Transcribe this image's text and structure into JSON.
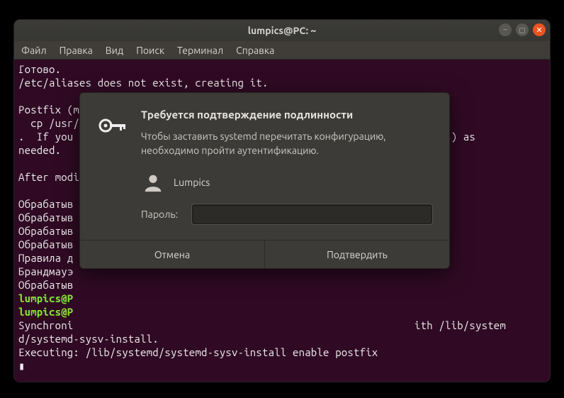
{
  "window": {
    "title": "lumpics@PC: ~"
  },
  "menubar": {
    "items": [
      "Файл",
      "Правка",
      "Вид",
      "Поиск",
      "Терминал",
      "Справка"
    ]
  },
  "terminal": {
    "lines": [
      "Готово.",
      "/etc/aliases does not exist, creating it.",
      "",
      "Postfix (main.cf) is now set up with                                       ",
      "  cp /usr/                                                                   ",
      ".  If you need                                                     hers) as ",
      "needed.                                                                     ",
      "",
      "After modifying main.cf, be sure to run  service postfix reload             ",
      "",
      "Обрабатыв                                                                   ",
      "Обрабатыв                                                                   ",
      "Обрабатыв                                                                   ",
      "Обрабатыв                                                                   ",
      "Правила д                                                                   ",
      "Брандмауэ                                                                   ",
      "Обрабатыв                                                                   "
    ],
    "prompt_lines": [
      "lumpics@P",
      "lumpics@P"
    ],
    "tail": [
      "Synchroni                                                        ith /lib/system",
      "d/systemd-sysv-install.",
      "Executing: /lib/systemd/systemd-sysv-install enable postfix",
      ""
    ]
  },
  "dialog": {
    "title": "Требуется подтверждение подлинности",
    "description": "Чтобы заставить systemd перечитать конфигурацию, необходимо пройти аутентификацию.",
    "username": "Lumpics",
    "password_label": "Пароль:",
    "password_value": "",
    "buttons": {
      "cancel": "Отмена",
      "confirm": "Подтвердить"
    }
  }
}
